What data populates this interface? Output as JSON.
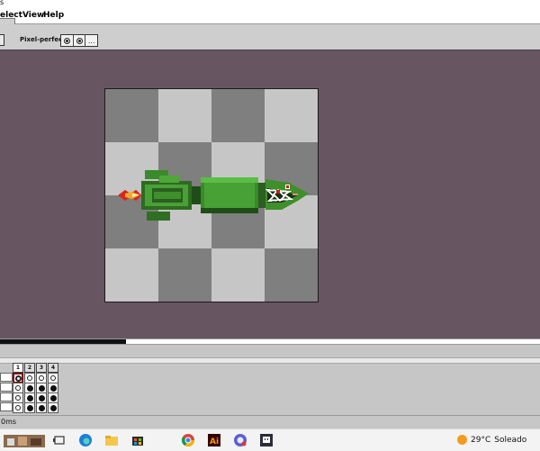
{
  "window": {
    "top_fragment": "s"
  },
  "menu": {
    "items": [
      "elect",
      "View",
      "Help"
    ]
  },
  "toolbar": {
    "pixel_perfect_label": "Pixel-perfect",
    "more_label": "..."
  },
  "timeline": {
    "frames": [
      "1",
      "2",
      "3",
      "4"
    ]
  },
  "status": {
    "duration_text": "0ms"
  },
  "taskbar": {
    "icons": [
      "desktop-thumbnail-icon",
      "task-view-icon",
      "edge-icon",
      "file-explorer-icon",
      "store-icon",
      "chrome-icon",
      "illustrator-icon",
      "chat-app-icon",
      "aseprite-icon"
    ],
    "weather_temp": "29°C",
    "weather_text": "Soleado"
  },
  "colors": {
    "workspace_bg": "#675562",
    "checker_dark": "#7f7f7f",
    "checker_light": "#c6c6c6",
    "sprite_green": "#3f8f2b"
  }
}
